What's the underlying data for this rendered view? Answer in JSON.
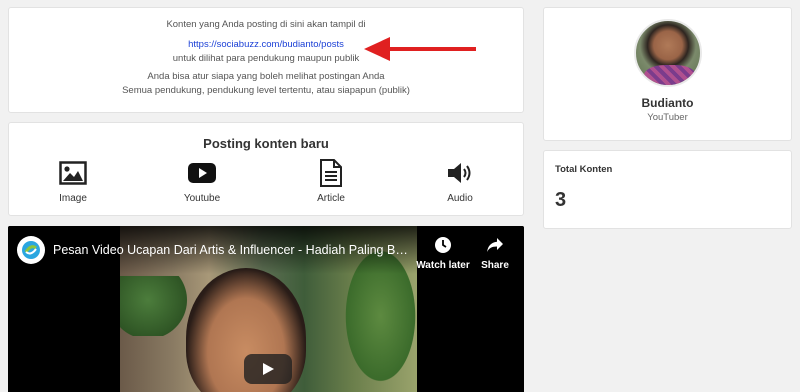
{
  "info": {
    "line1": "Konten yang Anda posting di sini akan tampil di",
    "link": "https://sociabuzz.com/budianto/posts",
    "line3": "untuk dilihat para pendukung maupun publik",
    "line4": "Anda bisa atur siapa yang boleh melihat postingan Anda",
    "line5": "Semua pendukung, pendukung level tertentu, atau siapapun (publik)",
    "arrow_color": "#e02020"
  },
  "posting": {
    "title": "Posting konten baru",
    "options": [
      {
        "label": "Image",
        "icon": "image-icon"
      },
      {
        "label": "Youtube",
        "icon": "youtube-icon"
      },
      {
        "label": "Article",
        "icon": "article-icon"
      },
      {
        "label": "Audio",
        "icon": "audio-icon"
      }
    ]
  },
  "video": {
    "title": "Pesan Video Ucapan Dari Artis & Influencer - Hadiah Paling Ber…",
    "watch_later": "Watch later",
    "share": "Share"
  },
  "profile": {
    "name": "Budianto",
    "role": "YouTuber"
  },
  "total": {
    "label": "Total Konten",
    "value": "3"
  }
}
